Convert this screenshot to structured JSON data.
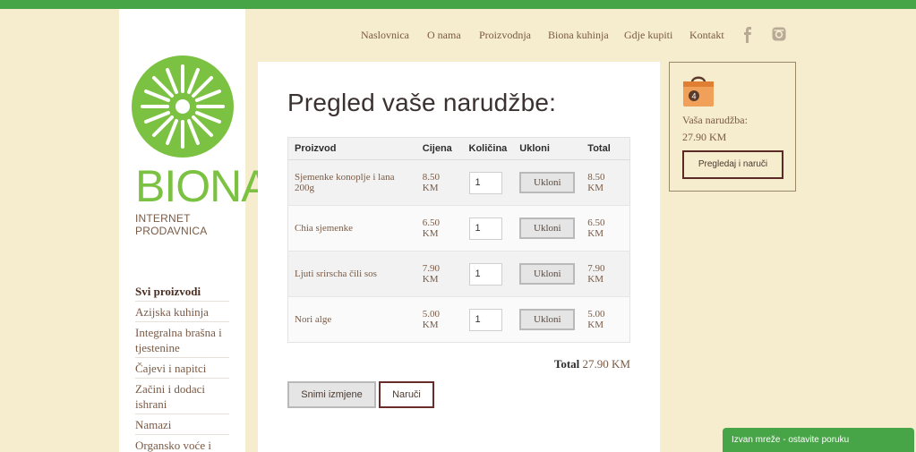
{
  "nav": {
    "items": [
      "Naslovnica",
      "O nama",
      "Proizvodnja",
      "Biona kuhinja",
      "Gdje kupiti",
      "Kontakt"
    ],
    "social_icons": [
      "facebook-icon",
      "instagram-icon"
    ]
  },
  "brand": {
    "name": "BIONA",
    "tagline": "INTERNET PRODAVNICA"
  },
  "sidebar": {
    "categories": [
      "Svi proizvodi",
      "Azijska kuhinja",
      "Integralna brašna i tjestenine",
      "Čajevi i napitci",
      "Začini i dodaci ishrani",
      "Namazi",
      "Organsko voće i"
    ]
  },
  "main": {
    "title": "Pregled vaše narudžbe:",
    "table": {
      "headers": [
        "Proizvod",
        "Cijena",
        "Količina",
        "Ukloni",
        "Total"
      ],
      "rows": [
        {
          "product": "Sjemenke konoplje i lana 200g",
          "price": "8.50 KM",
          "qty": "1",
          "remove": "Ukloni",
          "total": "8.50 KM"
        },
        {
          "product": "Chia sjemenke",
          "price": "6.50 KM",
          "qty": "1",
          "remove": "Ukloni",
          "total": "6.50 KM"
        },
        {
          "product": "Ljuti srirscha čili sos",
          "price": "7.90 KM",
          "qty": "1",
          "remove": "Ukloni",
          "total": "7.90 KM"
        },
        {
          "product": "Nori alge",
          "price": "5.00 KM",
          "qty": "1",
          "remove": "Ukloni",
          "total": "5.00 KM"
        }
      ]
    },
    "total_label": "Total",
    "total_value": "27.90 KM",
    "save_label": "Snimi izmjene",
    "order_label": "Naruči"
  },
  "cart": {
    "count": "4",
    "label": "Vaša narudžba:",
    "total": "27.90 KM",
    "button": "Pregledaj i naruči"
  },
  "chat": {
    "label": "Izvan mreže - ostavite poruku"
  },
  "colors": {
    "topbar": "#47a447",
    "background": "#f6ecce",
    "logo_green": "#7cc242",
    "accent_brown": "#6a2b2b"
  }
}
